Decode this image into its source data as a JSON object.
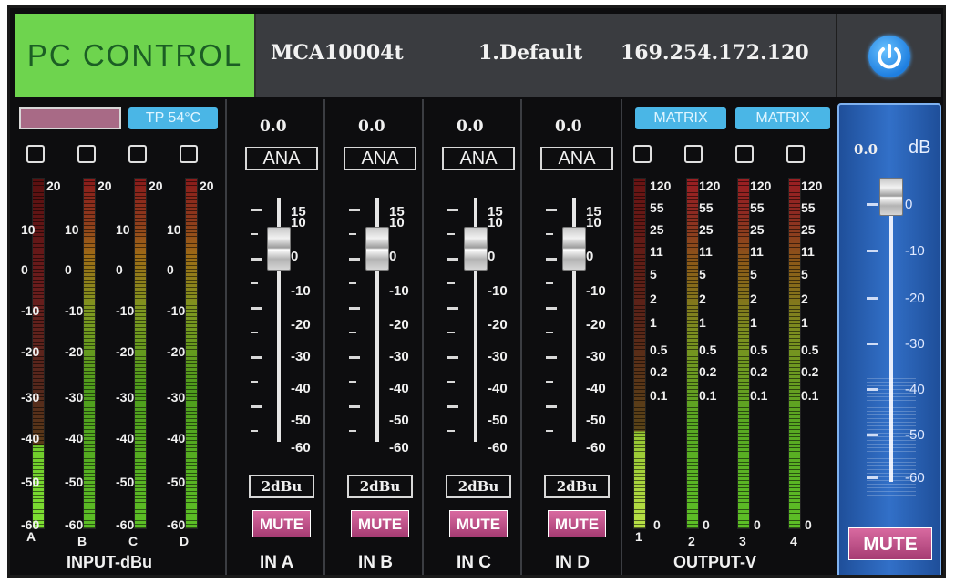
{
  "header": {
    "mode_label": "PC CONTROL",
    "device_model": "MCA10004t",
    "preset": "1.Default",
    "ip_address": "169.254.172.120",
    "power_icon": "power-icon"
  },
  "input_section": {
    "temp_badge": "TP 54°C",
    "meter_ticks": [
      "20",
      "10",
      "0",
      "-10",
      "-20",
      "-30",
      "-40",
      "-50",
      "-60"
    ],
    "channels": [
      "A",
      "B",
      "C",
      "D"
    ],
    "label": "INPUT-dBu"
  },
  "strips": [
    {
      "value": "0.0",
      "source": "ANA",
      "sens": "2dBu",
      "mute": "MUTE",
      "name": "IN A"
    },
    {
      "value": "0.0",
      "source": "ANA",
      "sens": "2dBu",
      "mute": "MUTE",
      "name": "IN B"
    },
    {
      "value": "0.0",
      "source": "ANA",
      "sens": "2dBu",
      "mute": "MUTE",
      "name": "IN C"
    },
    {
      "value": "0.0",
      "source": "ANA",
      "sens": "2dBu",
      "mute": "MUTE",
      "name": "IN D"
    }
  ],
  "fader_scale": [
    "15",
    "10",
    "0",
    "-10",
    "-20",
    "-30",
    "-40",
    "-50",
    "-60"
  ],
  "output_section": {
    "matrix_badge": "MATRIX",
    "meter_ticks": [
      "120",
      "55",
      "25",
      "11",
      "5",
      "2",
      "1",
      "0.5",
      "0.2",
      "0.1",
      "0"
    ],
    "channels": [
      "1",
      "2",
      "3",
      "4"
    ],
    "label": "OUTPUT-V"
  },
  "master": {
    "value": "0.0",
    "unit": "dB",
    "scale": [
      "0",
      "-10",
      "-20",
      "-30",
      "-40",
      "-50",
      "-60"
    ],
    "mute": "MUTE"
  }
}
